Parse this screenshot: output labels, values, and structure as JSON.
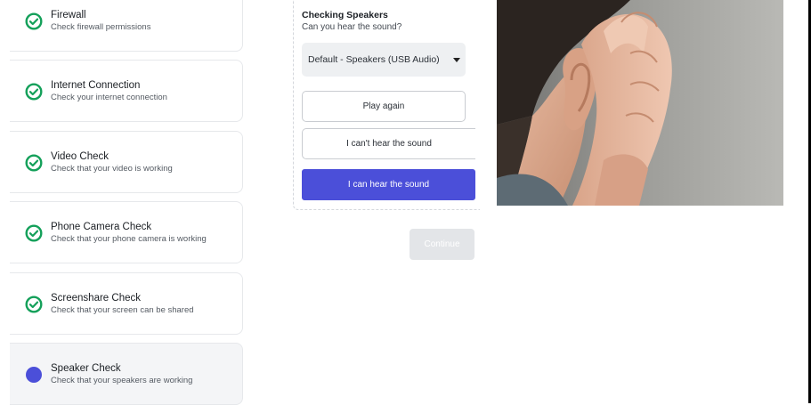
{
  "steps": [
    {
      "title": "Firewall",
      "subtitle": "Check firewall permissions",
      "status": "complete"
    },
    {
      "title": "Internet Connection",
      "subtitle": "Check your internet connection",
      "status": "complete"
    },
    {
      "title": "Video Check",
      "subtitle": "Check that your video is working",
      "status": "complete"
    },
    {
      "title": "Phone Camera Check",
      "subtitle": "Check that your phone camera is working",
      "status": "complete"
    },
    {
      "title": "Screenshare Check",
      "subtitle": "Check that your screen can be shared",
      "status": "complete"
    },
    {
      "title": "Speaker Check",
      "subtitle": "Check that your speakers are working",
      "status": "in-progress"
    }
  ],
  "speaker_panel": {
    "title": "Checking Speakers",
    "question": "Can you hear the sound?",
    "device_selected": "Default - Speakers (USB Audio)",
    "play_again_label": "Play again",
    "cant_hear_label": "I can't hear the sound",
    "can_hear_label": "I can hear the sound"
  },
  "continue_label": "Continue",
  "icons": {
    "complete": "check-circle-icon",
    "in_progress": "progress-dot-icon",
    "dropdown": "caret-down-icon"
  },
  "colors": {
    "accent": "#4b4fd9",
    "success": "#14a05a",
    "disabled": "#e3e5e8"
  }
}
